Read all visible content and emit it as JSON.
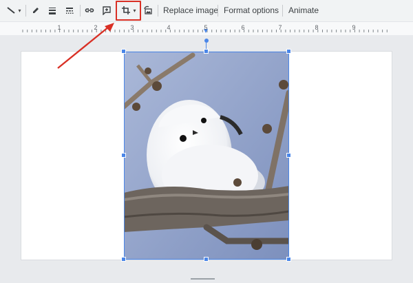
{
  "toolbar": {
    "replace_image_label": "Replace image",
    "format_options_label": "Format options",
    "animate_label": "Animate"
  },
  "ruler": {
    "labels": [
      "1",
      "2",
      "3",
      "4",
      "5",
      "6",
      "7",
      "8",
      "9"
    ]
  },
  "colors": {
    "highlight": "#d93025",
    "selection": "#4a86e8",
    "annotation_arrow": "#d93025"
  },
  "icons": {
    "line": "line-style-icon",
    "pen": "pencil-icon",
    "weight": "line-weight-icon",
    "dash": "line-dash-icon",
    "link": "link-icon",
    "comment": "add-comment-icon",
    "crop": "crop-icon",
    "reset": "reset-image-icon"
  }
}
